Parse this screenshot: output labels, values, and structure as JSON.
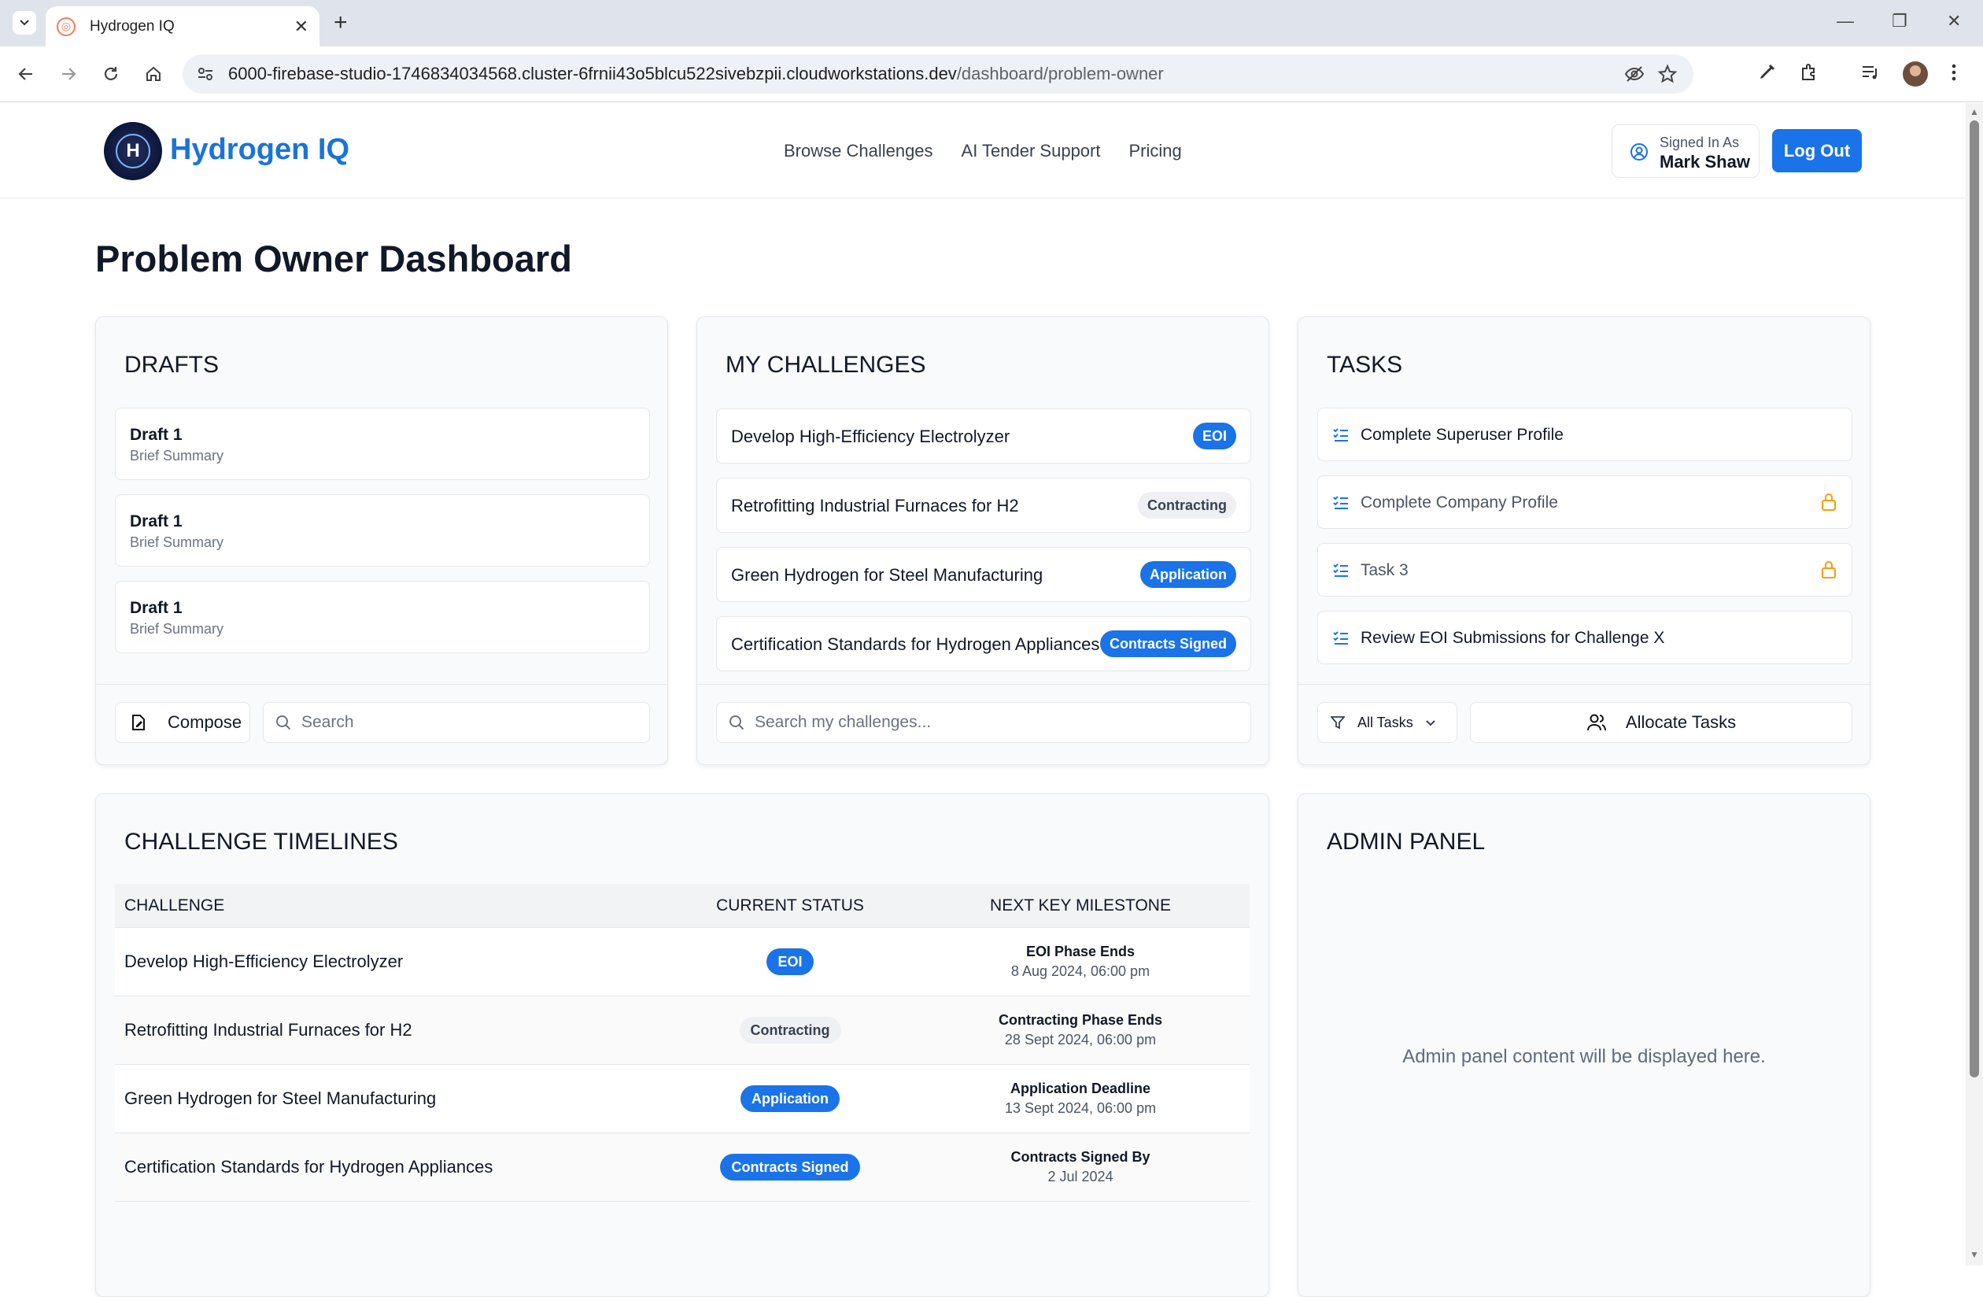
{
  "browser": {
    "tab_title": "Hydrogen IQ",
    "url_main": "6000-firebase-studio-1746834034568.cluster-6frnii43o5blcu522sivebzpii.cloudworkstations.dev",
    "url_path": "/dashboard/problem-owner"
  },
  "header": {
    "logo_text": "H",
    "brand": "Hydrogen IQ",
    "nav": [
      "Browse Challenges",
      "AI Tender Support",
      "Pricing"
    ],
    "signed_in_label": "Signed In As",
    "user_name": "Mark Shaw",
    "logout": "Log Out"
  },
  "page_title": "Problem Owner Dashboard",
  "drafts": {
    "title": "DRAFTS",
    "items": [
      {
        "title": "Draft 1",
        "summary": "Brief Summary"
      },
      {
        "title": "Draft 1",
        "summary": "Brief Summary"
      },
      {
        "title": "Draft 1",
        "summary": "Brief Summary"
      }
    ],
    "compose": "Compose",
    "search_placeholder": "Search"
  },
  "my_challenges": {
    "title": "MY CHALLENGES",
    "items": [
      {
        "title": "Develop High-Efficiency Electrolyzer",
        "status": "EOI",
        "style": "blue"
      },
      {
        "title": "Retrofitting Industrial Furnaces for H2",
        "status": "Contracting",
        "style": "gray"
      },
      {
        "title": "Green Hydrogen for Steel Manufacturing",
        "status": "Application",
        "style": "blue"
      },
      {
        "title": "Certification Standards for Hydrogen Appliances",
        "status": "Contracts Signed",
        "style": "blue"
      }
    ],
    "search_placeholder": "Search my challenges..."
  },
  "tasks": {
    "title": "TASKS",
    "items": [
      {
        "title": "Complete Superuser Profile",
        "locked": false
      },
      {
        "title": "Complete Company Profile",
        "locked": true
      },
      {
        "title": "Task 3",
        "locked": true
      },
      {
        "title": "Review EOI Submissions for Challenge X",
        "locked": false
      }
    ],
    "filter": "All Tasks",
    "allocate": "Allocate Tasks"
  },
  "timelines": {
    "title": "CHALLENGE TIMELINES",
    "columns": [
      "CHALLENGE",
      "CURRENT STATUS",
      "NEXT KEY MILESTONE"
    ],
    "rows": [
      {
        "challenge": "Develop High-Efficiency Electrolyzer",
        "status": "EOI",
        "style": "blue",
        "milestone": "EOI Phase Ends",
        "date": "8 Aug 2024, 06:00 pm"
      },
      {
        "challenge": "Retrofitting Industrial Furnaces for H2",
        "status": "Contracting",
        "style": "gray",
        "milestone": "Contracting Phase Ends",
        "date": "28 Sept 2024, 06:00 pm"
      },
      {
        "challenge": "Green Hydrogen for Steel Manufacturing",
        "status": "Application",
        "style": "blue",
        "milestone": "Application Deadline",
        "date": "13 Sept 2024, 06:00 pm"
      },
      {
        "challenge": "Certification Standards for Hydrogen Appliances",
        "status": "Contracts Signed",
        "style": "blue",
        "milestone": "Contracts Signed By",
        "date": "2 Jul 2024"
      }
    ]
  },
  "admin": {
    "title": "ADMIN PANEL",
    "message": "Admin panel content will be displayed here."
  },
  "colors": {
    "accent": "#1a73e8",
    "brand": "#1a73d9",
    "lock": "#f59e0b"
  }
}
